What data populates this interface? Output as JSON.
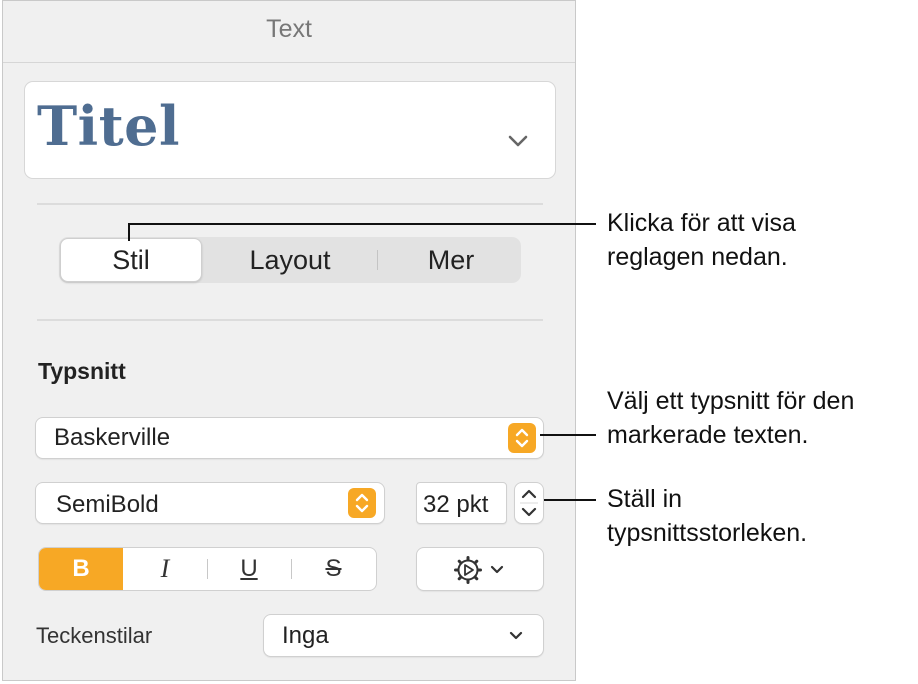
{
  "panel": {
    "title": "Text",
    "paragraph_style": {
      "name": "Titel",
      "icon": "chevron-down-icon"
    },
    "tabs": [
      {
        "label": "Stil",
        "active": true
      },
      {
        "label": "Layout",
        "active": false
      },
      {
        "label": "Mer",
        "active": false
      }
    ],
    "font_section": {
      "heading": "Typsnitt",
      "font_family": "Baskerville",
      "font_typeface": "SemiBold",
      "font_size": "32 pkt",
      "format_buttons": [
        {
          "label": "B",
          "name": "bold",
          "active": true
        },
        {
          "label": "I",
          "name": "italic",
          "active": false
        },
        {
          "label": "U",
          "name": "underline",
          "active": false
        },
        {
          "label": "S",
          "name": "strikethrough",
          "active": false
        }
      ],
      "options_icon": "gear-icon",
      "char_styles_label": "Teckenstilar",
      "char_styles_value": "Inga"
    }
  },
  "callouts": {
    "tabs_line1": "Klicka för att visa",
    "tabs_line2": "reglagen nedan.",
    "font_line1": "Välj ett typsnitt för den",
    "font_line2": "markerade texten.",
    "size_line1": "Ställ in",
    "size_line2": "typsnittsstorleken."
  },
  "colors": {
    "accent": "#f7a825",
    "style_text": "#4f6d91"
  }
}
